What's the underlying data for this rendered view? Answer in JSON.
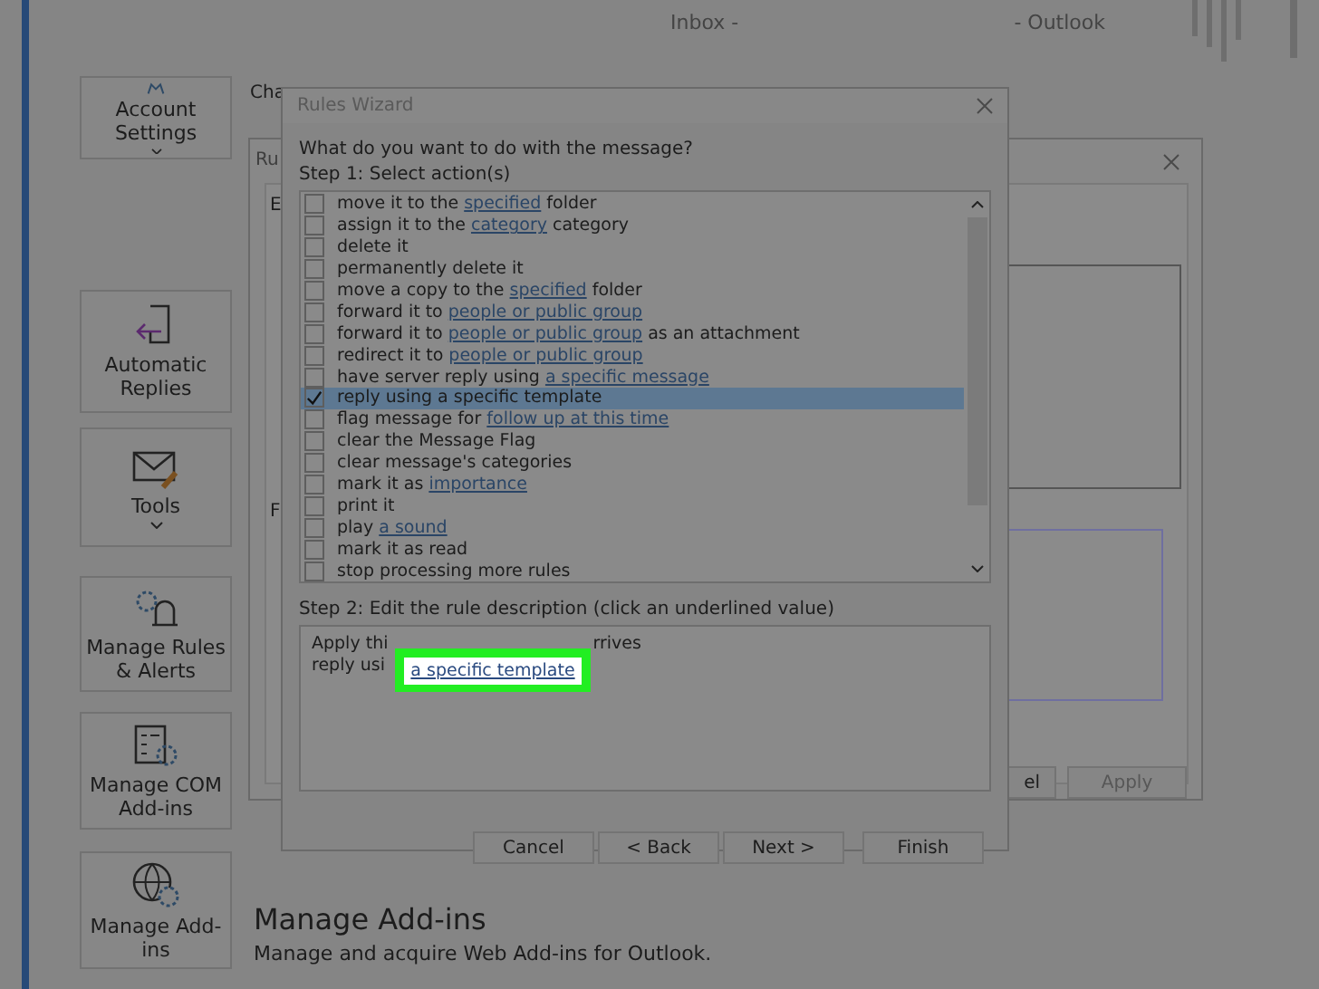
{
  "window": {
    "title_left": "Inbox -",
    "title_right": "- Outlook"
  },
  "sidebar": {
    "items": [
      {
        "label": "Account Settings",
        "dropdown": true
      },
      {
        "label": "Automatic Replies",
        "dropdown": false
      },
      {
        "label": "Tools",
        "dropdown": true
      },
      {
        "label": "Manage Rules & Alerts",
        "dropdown": false
      },
      {
        "label": "Manage COM Add-ins",
        "dropdown": false
      },
      {
        "label": "Manage Add-ins",
        "dropdown": false
      }
    ]
  },
  "page_text": {
    "partial_heading": "Cha",
    "section_title": "Manage Add-ins",
    "section_text": "Manage and acquire Web Add-ins for Outlook."
  },
  "back_dialog": {
    "title": "Ru",
    "label_1": "E",
    "label_2": "F",
    "buttons": [
      {
        "label": "el",
        "disabled": false
      },
      {
        "label": "Apply",
        "disabled": true
      }
    ]
  },
  "rules_wizard": {
    "title": "Rules Wizard",
    "question": "What do you want to do with the message?",
    "step1": "Step 1: Select action(s)",
    "actions": [
      {
        "parts": [
          {
            "text": "move it to the "
          },
          {
            "text": "specified",
            "link": true
          },
          {
            "text": " folder"
          }
        ],
        "checked": false,
        "selected": false
      },
      {
        "parts": [
          {
            "text": "assign it to the "
          },
          {
            "text": "category",
            "link": true
          },
          {
            "text": " category"
          }
        ],
        "checked": false,
        "selected": false
      },
      {
        "parts": [
          {
            "text": "delete it"
          }
        ],
        "checked": false,
        "selected": false
      },
      {
        "parts": [
          {
            "text": "permanently delete it"
          }
        ],
        "checked": false,
        "selected": false
      },
      {
        "parts": [
          {
            "text": "move a copy to the "
          },
          {
            "text": "specified",
            "link": true
          },
          {
            "text": " folder"
          }
        ],
        "checked": false,
        "selected": false
      },
      {
        "parts": [
          {
            "text": "forward it to "
          },
          {
            "text": "people or public group",
            "link": true
          }
        ],
        "checked": false,
        "selected": false
      },
      {
        "parts": [
          {
            "text": "forward it to "
          },
          {
            "text": "people or public group",
            "link": true
          },
          {
            "text": " as an attachment"
          }
        ],
        "checked": false,
        "selected": false
      },
      {
        "parts": [
          {
            "text": "redirect it to "
          },
          {
            "text": "people or public group",
            "link": true
          }
        ],
        "checked": false,
        "selected": false
      },
      {
        "parts": [
          {
            "text": "have server reply using "
          },
          {
            "text": "a specific message",
            "link": true
          }
        ],
        "checked": false,
        "selected": false
      },
      {
        "parts": [
          {
            "text": "reply using a specific template"
          }
        ],
        "checked": true,
        "selected": true
      },
      {
        "parts": [
          {
            "text": "flag message for "
          },
          {
            "text": "follow up at this time",
            "link": true
          }
        ],
        "checked": false,
        "selected": false
      },
      {
        "parts": [
          {
            "text": "clear the Message Flag"
          }
        ],
        "checked": false,
        "selected": false
      },
      {
        "parts": [
          {
            "text": "clear message's categories"
          }
        ],
        "checked": false,
        "selected": false
      },
      {
        "parts": [
          {
            "text": "mark it as "
          },
          {
            "text": "importance",
            "link": true
          }
        ],
        "checked": false,
        "selected": false
      },
      {
        "parts": [
          {
            "text": "print it"
          }
        ],
        "checked": false,
        "selected": false
      },
      {
        "parts": [
          {
            "text": "play "
          },
          {
            "text": "a sound",
            "link": true
          }
        ],
        "checked": false,
        "selected": false
      },
      {
        "parts": [
          {
            "text": "mark it as read"
          }
        ],
        "checked": false,
        "selected": false
      },
      {
        "parts": [
          {
            "text": "stop processing more rules"
          }
        ],
        "checked": false,
        "selected": false
      }
    ],
    "step2": "Step 2: Edit the rule description (click an underlined value)",
    "description": {
      "line1_start": "Apply thi",
      "line1_end": "rrives",
      "line2_start": "reply usi",
      "highlighted_link": "a specific template"
    },
    "buttons": [
      {
        "label": "Cancel",
        "disabled": false
      },
      {
        "label": "< Back",
        "disabled": false
      },
      {
        "label": "Next >",
        "disabled": false
      },
      {
        "label": "Finish",
        "disabled": false
      }
    ]
  }
}
